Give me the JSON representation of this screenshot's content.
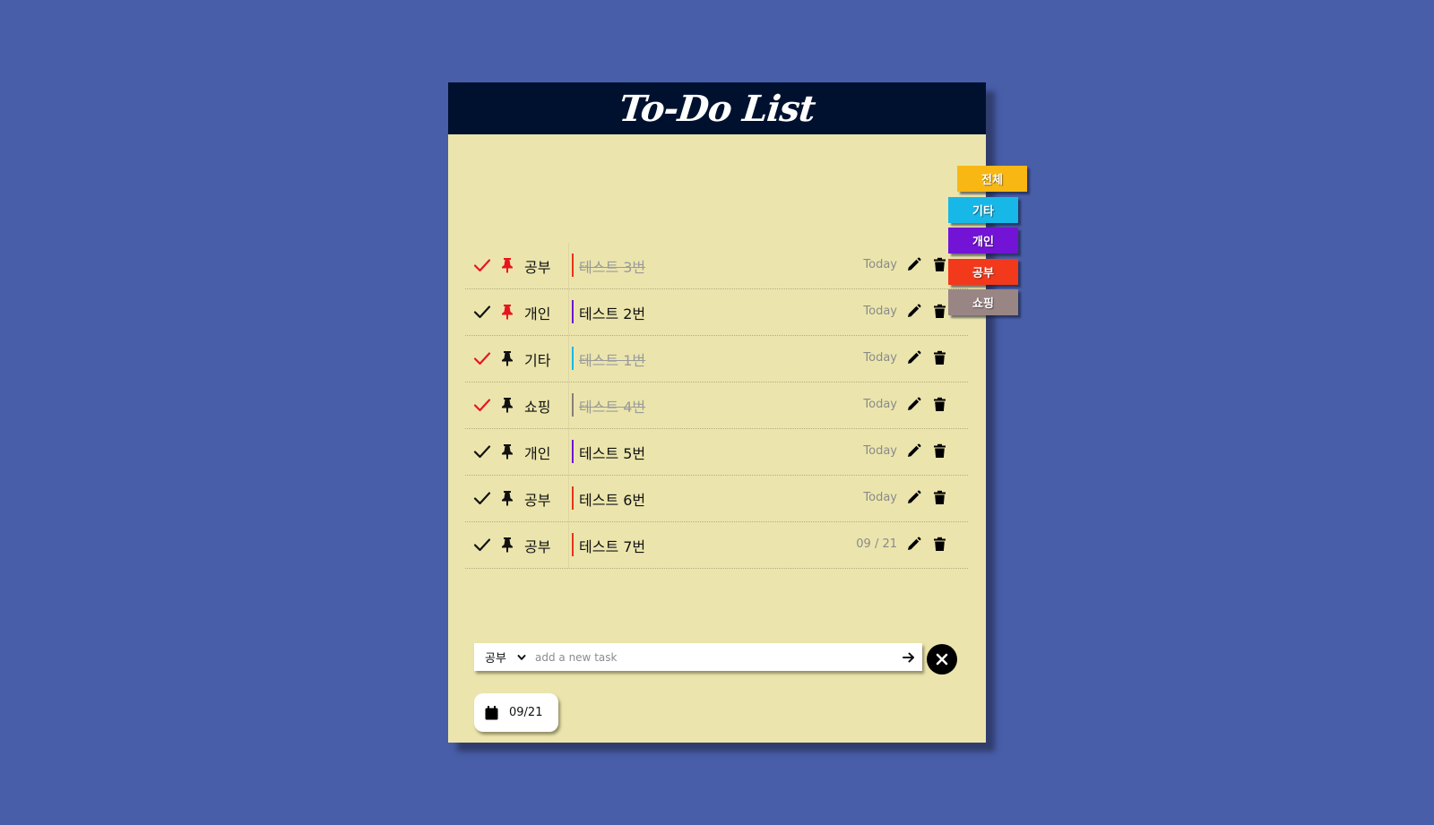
{
  "app": {
    "title": "To-Do List"
  },
  "colors": {
    "background": "#485ea9",
    "card": "#ebe5ad",
    "header": "#00112f",
    "check_done": "#e8161c",
    "check_pending": "#111111",
    "pin_active": "#e8161c",
    "pin_inactive": "#111111"
  },
  "categories": {
    "공부": "#e8321c",
    "개인": "#7213d6",
    "기타": "#17b8e8",
    "쇼핑": "#8a7c7c"
  },
  "tasks": [
    {
      "category": "공부",
      "text": "테스트 3번",
      "date": "Today",
      "done": true,
      "pinned": true
    },
    {
      "category": "개인",
      "text": "테스트 2번",
      "date": "Today",
      "done": false,
      "pinned": true
    },
    {
      "category": "기타",
      "text": "테스트 1번",
      "date": "Today",
      "done": true,
      "pinned": false
    },
    {
      "category": "쇼핑",
      "text": "테스트 4번",
      "date": "Today",
      "done": true,
      "pinned": false
    },
    {
      "category": "개인",
      "text": "테스트 5번",
      "date": "Today",
      "done": false,
      "pinned": false
    },
    {
      "category": "공부",
      "text": "테스트 6번",
      "date": "Today",
      "done": false,
      "pinned": false
    },
    {
      "category": "공부",
      "text": "테스트 7번",
      "date": "09 / 21",
      "done": false,
      "pinned": false
    }
  ],
  "filters": [
    {
      "label": "전체",
      "color": "#f8b713",
      "selected": true
    },
    {
      "label": "기타",
      "color": "#17b8e8",
      "selected": false
    },
    {
      "label": "개인",
      "color": "#7213d6",
      "selected": false
    },
    {
      "label": "공부",
      "color": "#f2391b",
      "selected": false
    },
    {
      "label": "쇼핑",
      "color": "#9a8585",
      "selected": false
    }
  ],
  "input": {
    "category_selected": "공부",
    "placeholder": "add a new task",
    "value": ""
  },
  "date_picker": {
    "label": "09/21"
  },
  "icons": {
    "check": "check-icon",
    "pin": "pin-icon",
    "edit": "pencil-icon",
    "delete": "trash-icon",
    "submit": "arrow-right-icon",
    "close": "close-icon",
    "calendar": "calendar-icon",
    "dropdown": "chevron-down-icon"
  }
}
